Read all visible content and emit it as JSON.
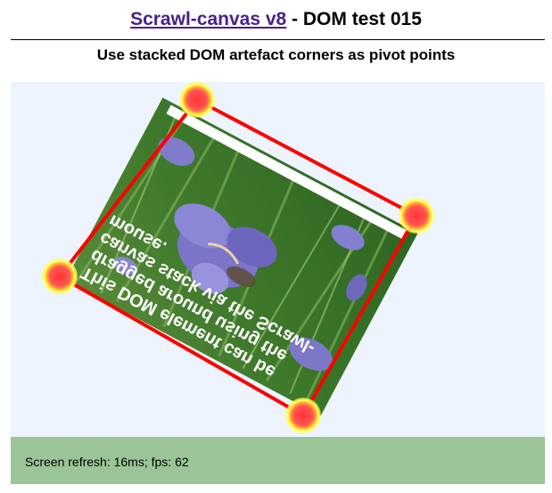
{
  "header": {
    "link_text": "Scrawl-canvas v8",
    "title_rest": " - DOM test 015",
    "subtitle": "Use stacked DOM artefact corners as pivot points"
  },
  "element": {
    "lines": [
      "This DOM element can be",
      "dragged around using the",
      "canvas stack via the Scrawl-",
      "mouse."
    ]
  },
  "status": {
    "text": "Screen refresh: 16ms; fps: 62"
  },
  "colors": {
    "link": "#4b1f8c",
    "stack_bg": "#edf4fd",
    "footer_bg": "#9bc599",
    "border": "#ff0000",
    "pivot_outer": "#ffff33",
    "pivot_inner": "#ff4444"
  }
}
